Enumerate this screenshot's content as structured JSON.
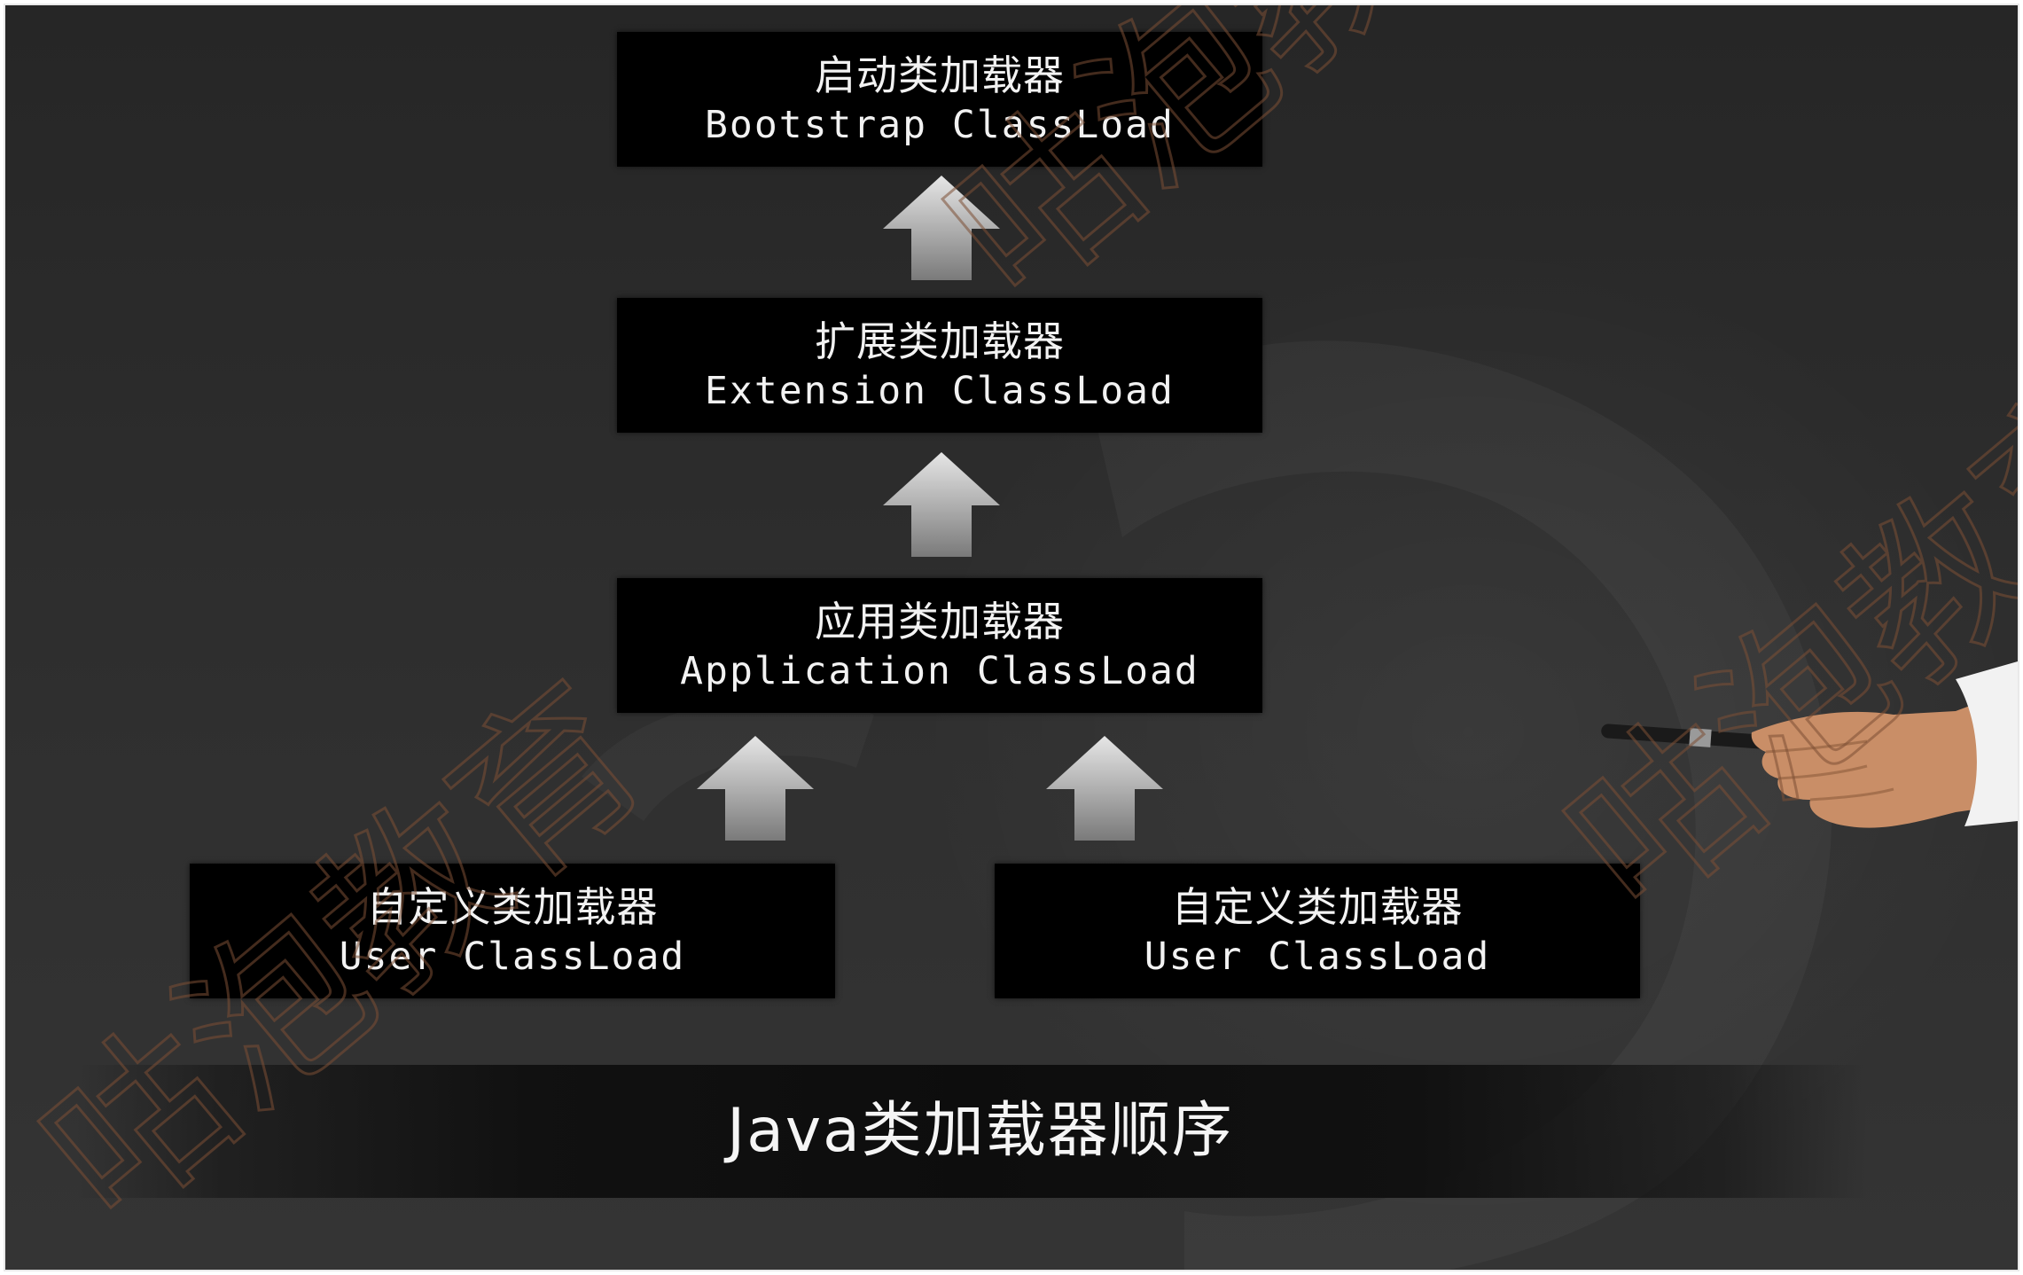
{
  "diagram": {
    "nodes": [
      {
        "id": "bootstrap",
        "name_zh": "启动类加载器",
        "name_en": "Bootstrap ClassLoad"
      },
      {
        "id": "extension",
        "name_zh": "扩展类加载器",
        "name_en": "Extension ClassLoad"
      },
      {
        "id": "application",
        "name_zh": "应用类加载器",
        "name_en": "Application ClassLoad"
      },
      {
        "id": "user1",
        "name_zh": "自定义类加载器",
        "name_en": "User ClassLoad"
      },
      {
        "id": "user2",
        "name_zh": "自定义类加载器",
        "name_en": "User ClassLoad"
      }
    ],
    "edges": [
      {
        "from": "extension",
        "to": "bootstrap"
      },
      {
        "from": "application",
        "to": "extension"
      },
      {
        "from": "user1",
        "to": "application"
      },
      {
        "from": "user2",
        "to": "application"
      }
    ]
  },
  "footer": {
    "title": "Java类加载器顺序"
  },
  "watermark": {
    "text": "咕泡教育"
  },
  "colors": {
    "background": "#2b2b2b",
    "box": "#000000",
    "text": "#f2f2f2",
    "arrow": "#bdbdbd",
    "watermark": "#8b5a3c"
  }
}
